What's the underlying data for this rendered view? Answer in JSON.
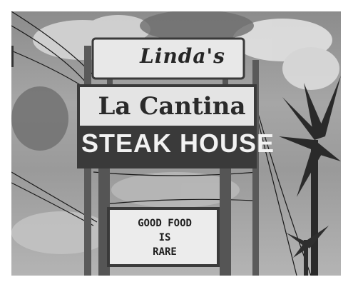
{
  "signs": {
    "top_sign": "Linda's",
    "main_sign_upper": "La Cantina",
    "main_sign_lower": "STEAK HOUSE",
    "marquee_lines": [
      "GOOD FOOD",
      "IS",
      "RARE"
    ]
  },
  "colors": {
    "sky": "#9e9e9e",
    "sign_face": "#e6e6e6",
    "sign_dark": "#3a3a3a",
    "poles": "#5a5a5a",
    "palm": "#2a2a2a"
  }
}
